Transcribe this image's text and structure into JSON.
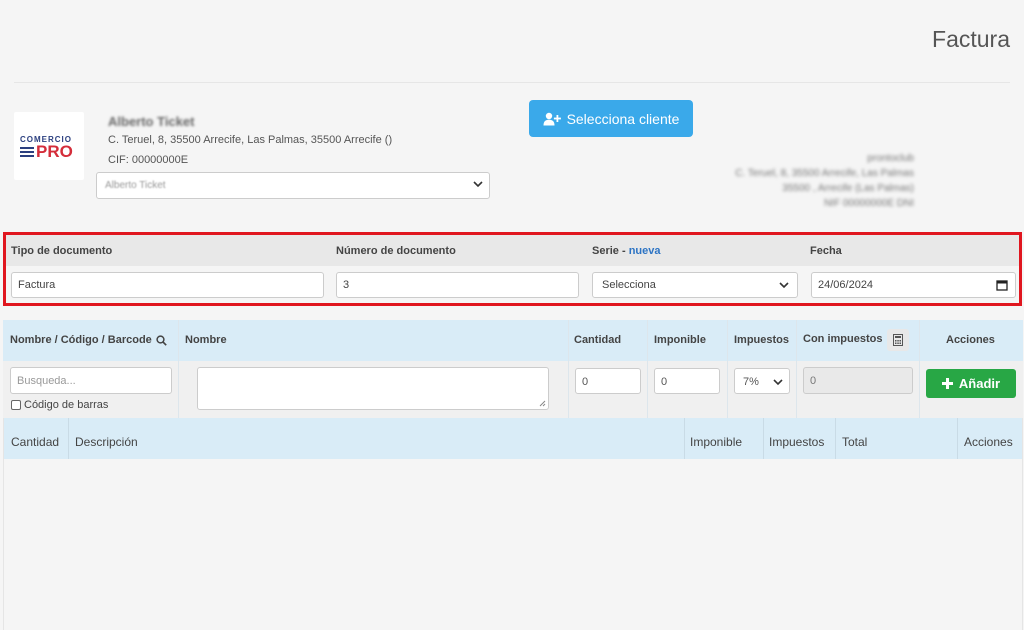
{
  "header": {
    "title": "Factura"
  },
  "company": {
    "logo_top": "COMERCIO",
    "logo_main": "PRO",
    "name": "Alberto Ticket",
    "address": "C. Teruel, 8, 35500 Arrecife, Las Palmas, 35500 Arrecife ()",
    "cif": "CIF: 00000000E",
    "select_value": "Alberto Ticket"
  },
  "client": {
    "button_label": "Selecciona cliente",
    "info_lines": [
      "prontoclub",
      "C. Teruel, 8, 35500 Arrecife, Las Palmas",
      "35500 , Arrecife (Las Palmas)",
      "NIF 00000000E DNI"
    ]
  },
  "document": {
    "tipo_label": "Tipo de documento",
    "numero_label": "Número de documento",
    "serie_label": "Serie",
    "serie_separator": " - ",
    "serie_link": "nueva",
    "fecha_label": "Fecha",
    "tipo_value": "Factura",
    "numero_value": "3",
    "serie_value": "Selecciona",
    "fecha_value": "24/06/2024"
  },
  "item_entry": {
    "headers": {
      "code": "Nombre / Código / Barcode",
      "name": "Nombre",
      "qty": "Cantidad",
      "taxable": "Imponible",
      "taxes": "Impuestos",
      "with_taxes": "Con impuestos",
      "actions": "Acciones"
    },
    "search_placeholder": "Busqueda...",
    "barcode_checkbox": "Código de barras",
    "qty_value": "0",
    "taxable_value": "0",
    "tax_value": "7%",
    "with_taxes_value": "0",
    "add_button": "Añadir"
  },
  "lines_table": {
    "headers": [
      "Cantidad",
      "Descripción",
      "Imponible",
      "Impuestos",
      "Total",
      "Acciones"
    ]
  },
  "colors": {
    "primary_button": "#3aa9ea",
    "add_button": "#28a745",
    "highlight_border": "#e0161f",
    "table_header": "#d9ecf7"
  }
}
